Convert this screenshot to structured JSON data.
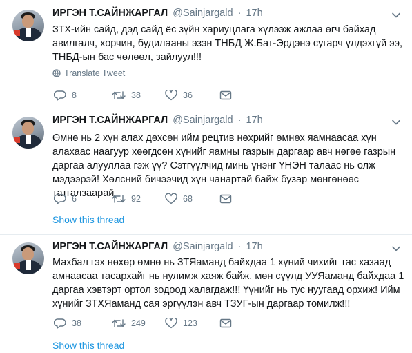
{
  "tweets": [
    {
      "name": "ИРГЭН Т.САЙНЖАРГАЛ",
      "handle": "@Sainjargald",
      "separator": "·",
      "time": "17h",
      "text": "ЗТХ-ийн сайд, дэд сайд ёс зүйн хариуцлага хүлээж ажлаа өгч байхад авилгалч, хорчин, будилааны эзэн ТНБД Ж.Бат-Эрдэнэ сугарч үлдэхгүй ээ, ТНБД-ын бас чөлөөл, зайлуул!!!",
      "translate": "Translate Tweet",
      "replies": "8",
      "retweets": "38",
      "likes": "36",
      "show_thread": ""
    },
    {
      "name": "ИРГЭН Т.САЙНЖАРГАЛ",
      "handle": "@Sainjargald",
      "separator": "·",
      "time": "17h",
      "text": "Өмнө нь 2 хүн алах дөхсөн ийм рецтив нөхрийг өмнөх яамнаасаа хүн алахаас наагуур хөөгдсөн хүнийг яамны газрын даргаар авч нөгөө газрын даргаа алууллаа гэж үү? Сэтгүүлчид минь үнэнг ҮНЭН талаас нь олж мэдээрэй! Хөлсний бичээчид хүн чанартай байж бузар мөнгөнөөс татгалзаарай",
      "translate": "",
      "replies": "6",
      "retweets": "92",
      "likes": "68",
      "show_thread": "Show this thread"
    },
    {
      "name": "ИРГЭН Т.САЙНЖАРГАЛ",
      "handle": "@Sainjargald",
      "separator": "·",
      "time": "17h",
      "text": "Махбал гэх нөхөр өмнө нь ЗТЯаманд байхдаа 1 хүний чихийг тас хазаад амнаасаа тасархайг нь нулимж хаяж байж, мөн сүүлд УУЯаманд байхдаа 1 даргаа хэвтэрт ортол зодоод халагдаж!!! Үүнийг нь тус нуугаад орхиж! Ийм хүнийг ЗТХЯаманд сая эргүүлэн авч ТЗУГ-ын даргаар томилж!!!",
      "translate": "",
      "replies": "38",
      "retweets": "249",
      "likes": "123",
      "show_thread": "Show this thread"
    }
  ],
  "colors": {
    "text": "#14171a",
    "secondary": "#657786",
    "link": "#1b95e0",
    "divider": "#e6ecf0"
  },
  "icons": [
    "chevron-down-icon",
    "globe-icon",
    "reply-icon",
    "retweet-icon",
    "like-icon",
    "dm-icon"
  ]
}
